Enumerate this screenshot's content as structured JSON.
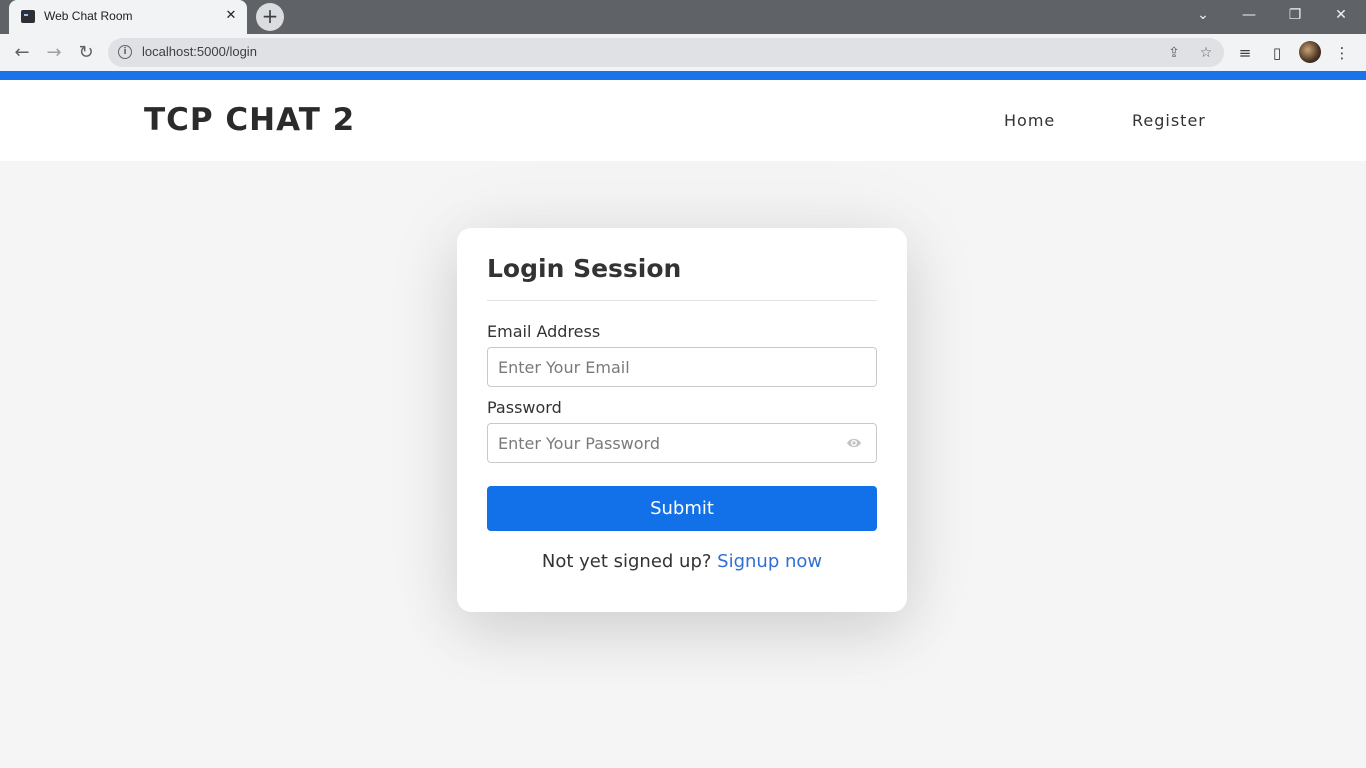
{
  "browser": {
    "tab_title": "Web Chat Room",
    "tab_close": "✕",
    "new_tab": "+",
    "url": "localhost:5000/login",
    "window_controls": [
      "⌄",
      "—",
      "❐",
      "✕"
    ]
  },
  "site": {
    "brand": "TCP CHAT 2",
    "nav": [
      "Home",
      "Register"
    ]
  },
  "login": {
    "title": "Login Session",
    "email_label": "Email Address",
    "email_placeholder": "Enter Your Email",
    "password_label": "Password",
    "password_placeholder": "Enter Your Password",
    "submit_label": "Submit",
    "signup_prompt": "Not yet signed up?",
    "signup_link": "Signup now"
  },
  "colors": {
    "accent": "#1a73e8",
    "button": "#1270e8",
    "link": "#2f6fd6",
    "page_bg": "#f5f5f5"
  }
}
